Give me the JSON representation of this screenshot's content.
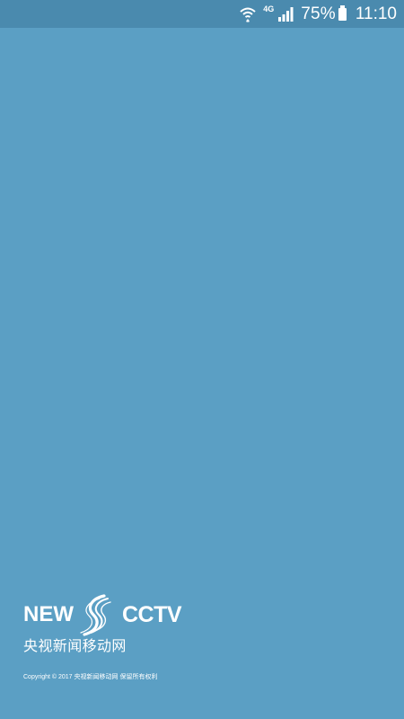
{
  "status_bar": {
    "network": "4G",
    "battery": "75%",
    "time": "11:10",
    "icons": [
      "wifi-icon",
      "signal-icon",
      "battery-icon"
    ]
  },
  "brand": {
    "logo_left": "NEW",
    "logo_right": "CCTV",
    "subtitle": "央视新闻移动网"
  },
  "footer": {
    "copyright": "Copyright © 2017 央视新闻移动网 保留所有权利"
  },
  "colors": {
    "background": "#5b9fc4",
    "status_bar": "#4a8aae",
    "text": "#ffffff"
  }
}
